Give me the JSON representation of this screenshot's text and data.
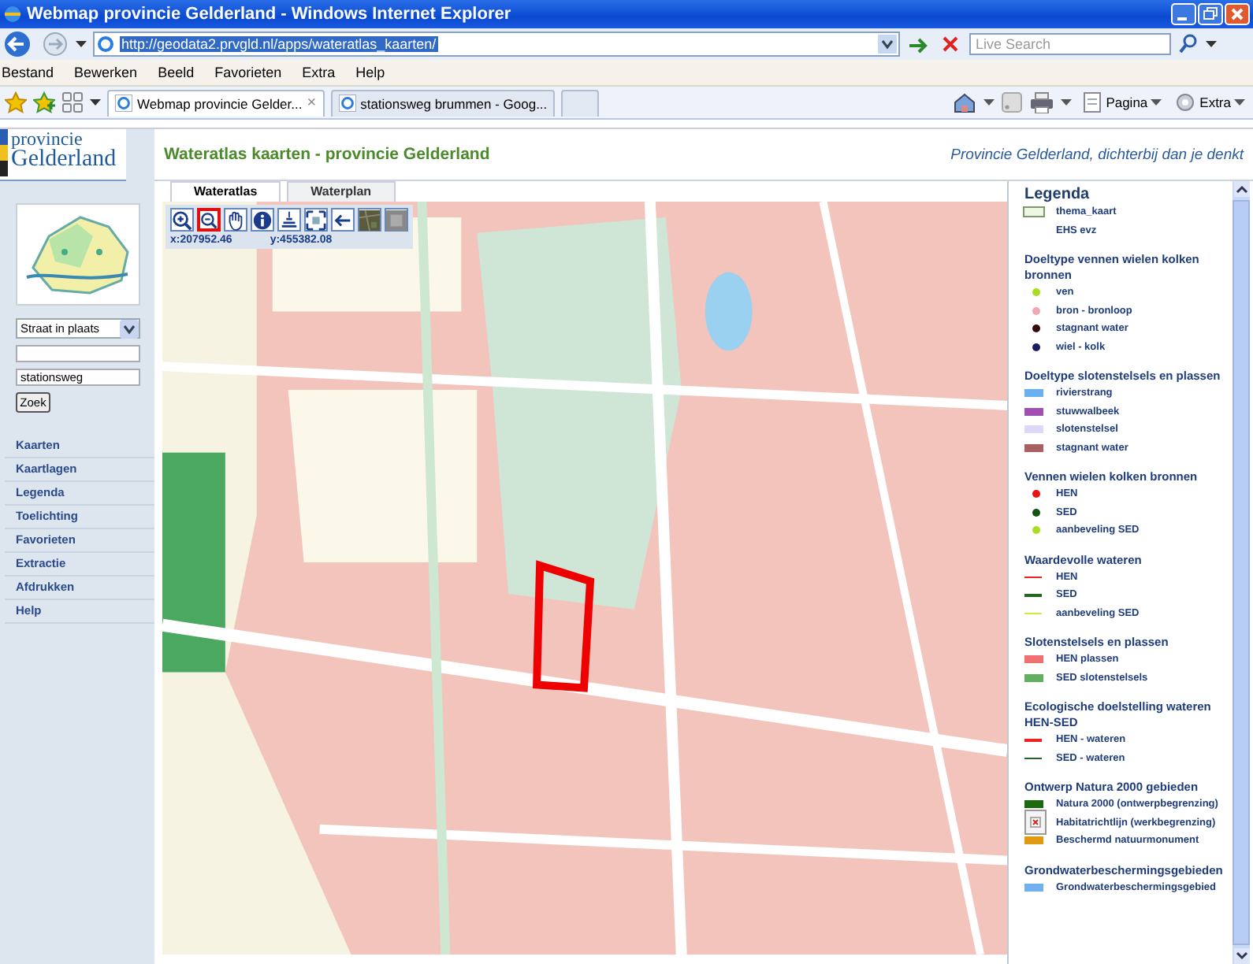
{
  "window": {
    "title": "Webmap provincie Gelderland - Windows Internet Explorer"
  },
  "address_bar": {
    "url": "http://geodata2.prvgld.nl/apps/wateratlas_kaarten/"
  },
  "search": {
    "placeholder": "Live Search"
  },
  "menu": [
    "Bestand",
    "Bewerken",
    "Beeld",
    "Favorieten",
    "Extra",
    "Help"
  ],
  "browser_tabs": [
    {
      "label": "Webmap provincie Gelder...",
      "selected": true,
      "close": "×"
    },
    {
      "label": "stationsweg brummen - Goog...",
      "selected": false
    }
  ],
  "command_bar": [
    {
      "kind": "page",
      "label": "Pagina"
    },
    {
      "kind": "tools",
      "label": "Extra"
    }
  ],
  "site": {
    "logo_top": "provincie",
    "logo_bottom": "Gelderland",
    "title": "Wateratlas kaarten - provincie Gelderland",
    "tagline": "Provincie Gelderland, dichterbij dan je denkt"
  },
  "search_panel": {
    "select": "Straat in plaats",
    "street_value": "stationsweg",
    "button": "Zoek"
  },
  "nav": [
    "Kaarten",
    "Kaartlagen",
    "Legenda",
    "Toelichting",
    "Favorieten",
    "Extractie",
    "Afdrukken",
    "Help"
  ],
  "map_tabs": [
    {
      "label": "Wateratlas",
      "selected": true
    },
    {
      "label": "Waterplan",
      "selected": false
    }
  ],
  "tools": [
    {
      "kind": "zoom-in",
      "selected": false
    },
    {
      "kind": "zoom-out",
      "selected": true
    },
    {
      "kind": "pan",
      "selected": false
    },
    {
      "kind": "info",
      "selected": false
    },
    {
      "kind": "layers",
      "selected": false
    },
    {
      "kind": "full-extent",
      "selected": false
    },
    {
      "kind": "back",
      "selected": false
    },
    {
      "kind": "aerial",
      "selected": false
    },
    {
      "kind": "plain",
      "selected": false
    }
  ],
  "coordinates": {
    "x": "x:207952.46",
    "y": "y:455382.08"
  },
  "legend": {
    "heading": "Legenda",
    "groups": [
      {
        "items": [
          {
            "kind": "box",
            "color": "#eef6e4",
            "label": "thema_kaart"
          },
          {
            "kind": "text",
            "label": "EHS evz"
          }
        ]
      },
      {
        "title": "Doeltype vennen wielen kolken bronnen",
        "items": [
          {
            "kind": "dot",
            "color": "#aadd22",
            "label": "ven"
          },
          {
            "kind": "dot",
            "color": "#f0a8b0",
            "label": "bron - bronloop"
          },
          {
            "kind": "dot",
            "color": "#3a0a0a",
            "label": "stagnant water"
          },
          {
            "kind": "dot",
            "color": "#1a1a60",
            "label": "wiel - kolk"
          }
        ]
      },
      {
        "title": "Doeltype slotenstelsels en plassen",
        "items": [
          {
            "kind": "box",
            "color": "#6ab0f0",
            "label": "rivierstrang"
          },
          {
            "kind": "box",
            "color": "#a050b0",
            "label": "stuwwalbeek"
          },
          {
            "kind": "box",
            "color": "#dcd8f5",
            "label": "slotenstelsel"
          },
          {
            "kind": "box",
            "color": "#a86060",
            "label": "stagnant water"
          }
        ]
      },
      {
        "title": "Vennen wielen kolken bronnen",
        "items": [
          {
            "kind": "dot",
            "color": "#ee1111",
            "label": "HEN"
          },
          {
            "kind": "dot",
            "color": "#115511",
            "label": "SED"
          },
          {
            "kind": "dot",
            "color": "#aadd22",
            "label": "aanbeveling SED"
          }
        ]
      },
      {
        "title": "Waardevolle wateren",
        "items": [
          {
            "kind": "line",
            "color": "#ee2222",
            "label": "HEN"
          },
          {
            "kind": "line",
            "color": "#226622",
            "label": "SED"
          },
          {
            "kind": "line",
            "color": "#ccee44",
            "label": "aanbeveling SED"
          }
        ]
      },
      {
        "title": "Slotenstelsels en plassen",
        "items": [
          {
            "kind": "box",
            "color": "#f07070",
            "label": "HEN plassen"
          },
          {
            "kind": "box",
            "color": "#60b060",
            "label": "SED slotenstelsels"
          }
        ]
      },
      {
        "title": "Ecologische doelstelling wateren HEN-SED",
        "items": [
          {
            "kind": "line",
            "color": "#ee2222",
            "label": "HEN - wateren"
          },
          {
            "kind": "line",
            "color": "#226622",
            "label": "SED - wateren"
          }
        ]
      },
      {
        "title": "Ontwerp Natura 2000 gebieden",
        "items": [
          {
            "kind": "box",
            "color": "#1a6a10",
            "label": "Natura 2000 (ontwerpbegrenzing)"
          },
          {
            "kind": "broken-image",
            "label": "Habitatrichtlijn (werkbegrenzing)"
          },
          {
            "kind": "box",
            "color": "#e09a10",
            "label": "Beschermd natuurmonument"
          }
        ]
      },
      {
        "title": "Grondwaterbeschermingsgebieden",
        "items": [
          {
            "kind": "box",
            "color": "#70b0f0",
            "label": "Grondwaterbeschermingsgebied"
          }
        ]
      }
    ]
  }
}
